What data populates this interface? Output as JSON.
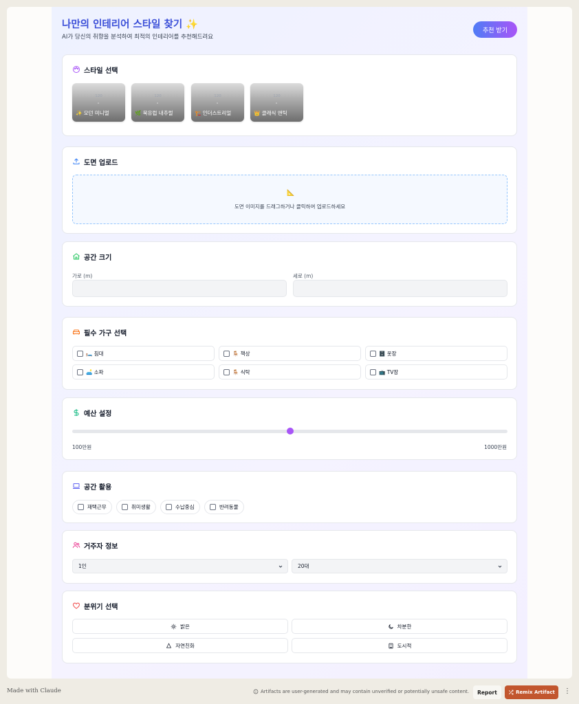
{
  "header": {
    "title": "나만의 인테리어 스타일 찾기 ✨",
    "subtitle": "AI가 당신의 취향을 분석하여 최적의 인테리어를 추천해드려요",
    "recommend_button": "추천 받기"
  },
  "style_section": {
    "title": "스타일 선택",
    "placeholder_size": "120",
    "placeholder_dot": "×",
    "options": [
      {
        "label": "✨ 모던 미니멀"
      },
      {
        "label": "🌿 북유럽 내추럴"
      },
      {
        "label": "🏗️ 인더스트리얼"
      },
      {
        "label": "👑 클래식 앤틱"
      }
    ]
  },
  "upload_section": {
    "title": "도면 업로드",
    "icon_glyph": "📐",
    "dropzone_text": "도면 이미지를 드래그하거나 클릭하여 업로드하세요"
  },
  "size_section": {
    "title": "공간 크기",
    "width_label": "가로 (m)",
    "height_label": "세로 (m)",
    "width_value": "",
    "height_value": ""
  },
  "furniture_section": {
    "title": "필수 가구 선택",
    "items": [
      {
        "label": "🛏️ 침대",
        "checked": false
      },
      {
        "label": "🪑 책상",
        "checked": false
      },
      {
        "label": "🗄️ 옷장",
        "checked": false
      },
      {
        "label": "🛋️ 소파",
        "checked": false
      },
      {
        "label": "🪑 식탁",
        "checked": false
      },
      {
        "label": "📺 TV장",
        "checked": false
      }
    ]
  },
  "budget_section": {
    "title": "예산 설정",
    "min_label": "100만원",
    "max_label": "1000만원",
    "level_fraction": 0.5
  },
  "usage_section": {
    "title": "공간 활용",
    "options": [
      {
        "label": "재택근무",
        "checked": false
      },
      {
        "label": "취미생활",
        "checked": false
      },
      {
        "label": "수납중심",
        "checked": false
      },
      {
        "label": "반려동물",
        "checked": false
      }
    ]
  },
  "resident_section": {
    "title": "거주자 정보",
    "count_value": "1인",
    "age_value": "20대"
  },
  "mood_section": {
    "title": "분위기 선택",
    "options": [
      {
        "label": "밝은",
        "icon": "sun-icon"
      },
      {
        "label": "차분한",
        "icon": "moon-icon"
      },
      {
        "label": "자연친화",
        "icon": "tree-icon"
      },
      {
        "label": "도시적",
        "icon": "building-icon"
      }
    ]
  },
  "footer": {
    "made_with": "Made with Claude",
    "disclaimer": "Artifacts are user-generated and may contain unverified or potentially unsafe content.",
    "report": "Report",
    "remix": "Remix Artifact"
  },
  "colors": {
    "accent_blue": "#3b4fd8",
    "gradient_start": "#4f7cf6",
    "gradient_end": "#a855f7",
    "remix_button": "#c2562e"
  }
}
